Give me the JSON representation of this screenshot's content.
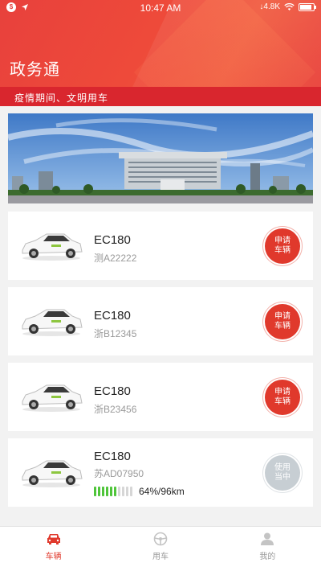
{
  "status_bar": {
    "time": "10:47 AM",
    "speed": "4.8K"
  },
  "app": {
    "title": "政务通",
    "slogan": "疫情期间、文明用车"
  },
  "vehicles": [
    {
      "model": "EC180",
      "plate": "测A22222",
      "action": "申请车辆",
      "action_line1": "申请",
      "action_line2": "车辆",
      "status": "available"
    },
    {
      "model": "EC180",
      "plate": "浙B12345",
      "action": "申请车辆",
      "action_line1": "申请",
      "action_line2": "车辆",
      "status": "available"
    },
    {
      "model": "EC180",
      "plate": "浙B23456",
      "action": "申请车辆",
      "action_line1": "申请",
      "action_line2": "车辆",
      "status": "available"
    },
    {
      "model": "EC180",
      "plate": "苏AD07950",
      "action": "使用当中",
      "action_line1": "使用",
      "action_line2": "当中",
      "status": "in_use",
      "battery_percent": 64,
      "battery_text": "64%/96km"
    }
  ],
  "tabs": [
    {
      "label": "车辆",
      "icon": "car-icon",
      "active": true
    },
    {
      "label": "用车",
      "icon": "steering-wheel-icon",
      "active": false
    },
    {
      "label": "我的",
      "icon": "user-icon",
      "active": false
    }
  ],
  "colors": {
    "brand_red": "#e8413c",
    "slogan_red": "#d9262e",
    "button_red": "#e0392c",
    "button_gray": "#c7ced3",
    "battery_green": "#4fc53a",
    "tab_active": "#e0392c",
    "tab_inactive": "#9a9a9a"
  }
}
